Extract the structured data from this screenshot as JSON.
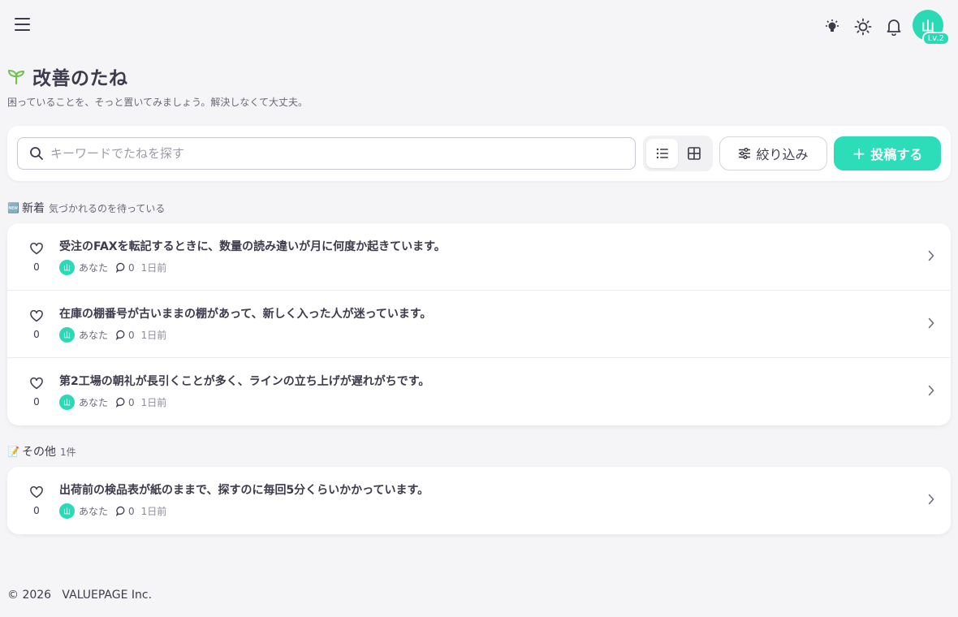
{
  "header": {
    "avatar_initial": "山",
    "level": "Lv.2"
  },
  "page": {
    "title": "改善のたね",
    "subtitle": "困っていることを、そっと置いてみましょう。解決しなくて大丈夫。"
  },
  "toolbar": {
    "search_placeholder": "キーワードでたねを探す",
    "filter_label": "絞り込み",
    "post_label": "投稿する"
  },
  "sections": [
    {
      "emoji": "🆕",
      "label": "新着",
      "sub": "気づかれるのを待っている",
      "items": [
        {
          "title": "受注のFAXを転記するときに、数量の読み違いが月に何度か起きています。",
          "likes": "0",
          "author": "あなた",
          "avatar": "山",
          "comments": "0",
          "time": "1日前"
        },
        {
          "title": "在庫の棚番号が古いままの棚があって、新しく入った人が迷っています。",
          "likes": "0",
          "author": "あなた",
          "avatar": "山",
          "comments": "0",
          "time": "1日前"
        },
        {
          "title": "第2工場の朝礼が長引くことが多く、ラインの立ち上げが遅れがちです。",
          "likes": "0",
          "author": "あなた",
          "avatar": "山",
          "comments": "0",
          "time": "1日前"
        }
      ]
    },
    {
      "emoji": "📝",
      "label": "その他",
      "sub": "1件",
      "items": [
        {
          "title": "出荷前の検品表が紙のままで、探すのに毎回5分くらいかかっています。",
          "likes": "0",
          "author": "あなた",
          "avatar": "山",
          "comments": "0",
          "time": "1日前"
        }
      ]
    }
  ],
  "footer": {
    "text": "© 2026   VALUEPAGE Inc."
  },
  "colors": {
    "accent": "#2ddcb8",
    "text": "#3d3a4b",
    "sprout": "#6cc24a"
  }
}
